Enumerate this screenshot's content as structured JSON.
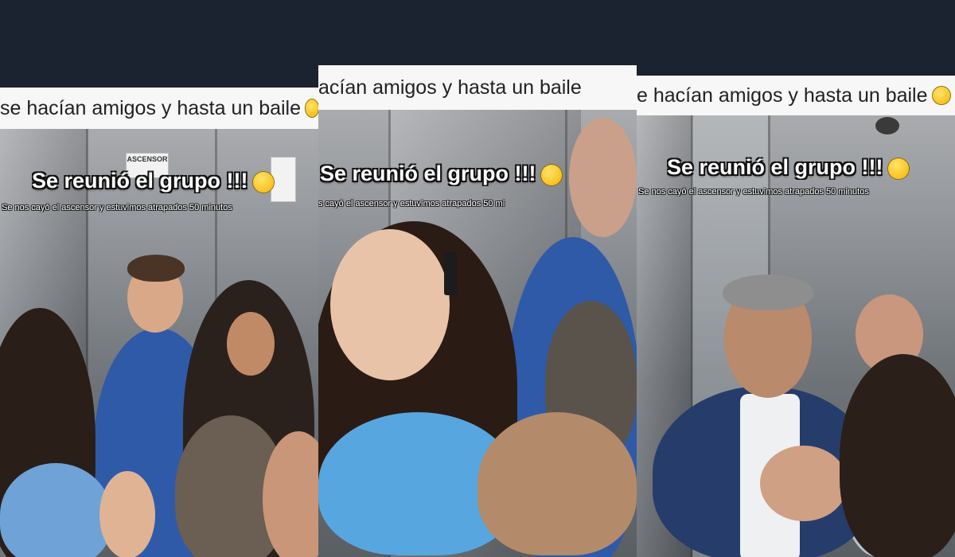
{
  "panels": [
    {
      "caption": "se hacían amigos y hasta un baile",
      "overlay_title": "Se reunió el grupo !!!",
      "overlay_subtitle": "Se nos cayó el ascensor y estuvimos atrapados 50 minutos",
      "sign_text": "ASCENSOR"
    },
    {
      "caption": "acían amigos y hasta un baile",
      "overlay_title": "Se reunió el grupo !!!",
      "overlay_subtitle": "s cayó el ascensor y estuvimos atrapados 50 mi"
    },
    {
      "caption": "e hacían amigos y hasta un baile",
      "overlay_title": "Se reunió el grupo !!!",
      "overlay_subtitle": "Se nos cayó el ascensor y estuvimos atrapados 50 minutos"
    }
  ],
  "icons": {
    "caption_emoji": "grinning-squinting-face-emoji",
    "title_emoji": "star-struck-face-emoji"
  },
  "colors": {
    "background": "#1b2230",
    "caption_bar": "#f7f7f8",
    "overlay_text": "#ffffff"
  }
}
